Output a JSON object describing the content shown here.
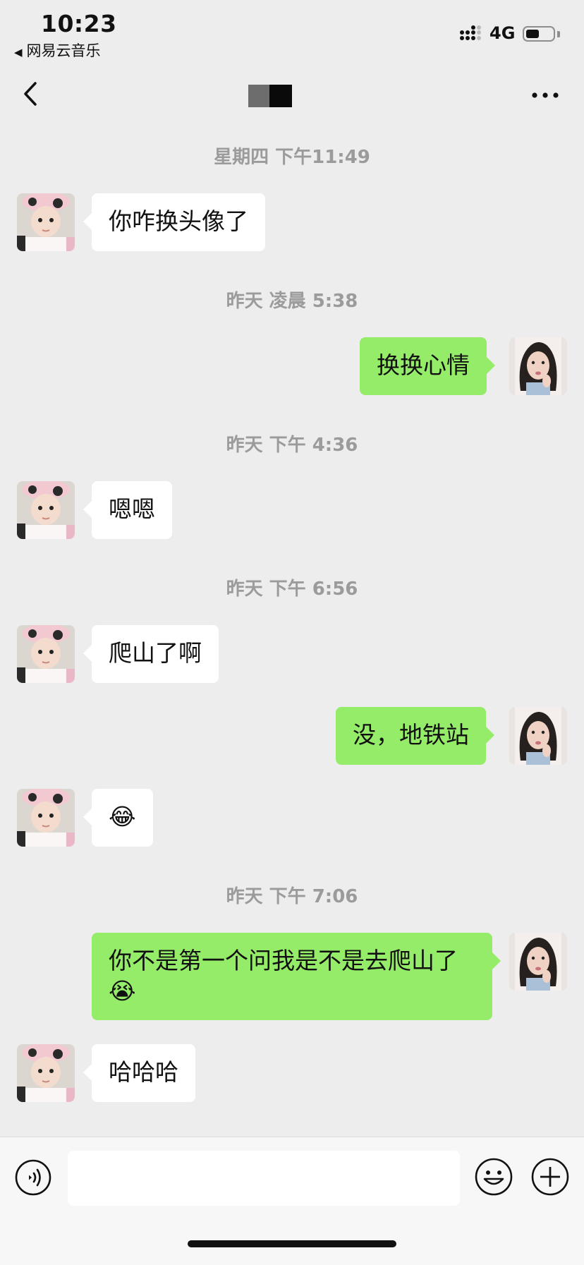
{
  "status_bar": {
    "time": "10:23",
    "back_app_label": "网易云音乐",
    "back_arrow": "◀",
    "network": "4G",
    "battery_level": 0.5
  },
  "nav_bar": {
    "back_icon": "chevron-left-icon",
    "more_icon": "more-dots-icon"
  },
  "messages": [
    {
      "type": "time",
      "text": "星期四 下午11:49"
    },
    {
      "type": "in",
      "text": "你咋换头像了"
    },
    {
      "type": "time",
      "text": "昨天 凌晨 5:38"
    },
    {
      "type": "out",
      "text": "换换心情"
    },
    {
      "type": "time",
      "text": "昨天 下午 4:36"
    },
    {
      "type": "in",
      "text": "嗯嗯"
    },
    {
      "type": "time",
      "text": "昨天 下午 6:56"
    },
    {
      "type": "in",
      "text": "爬山了啊"
    },
    {
      "type": "out",
      "text": "没，地铁站"
    },
    {
      "type": "in",
      "text": "😂"
    },
    {
      "type": "time",
      "text": "昨天 下午 7:06"
    },
    {
      "type": "out",
      "text": "你不是第一个问我是不是去爬山了😭"
    },
    {
      "type": "in",
      "text": "哈哈哈"
    }
  ],
  "input_bar": {
    "value": "",
    "voice_icon": "voice-icon",
    "emoji_icon": "emoji-icon",
    "plus_icon": "plus-icon"
  },
  "colors": {
    "background": "#ededed",
    "incoming_bubble": "#ffffff",
    "outgoing_bubble": "#95ec69",
    "timestamp": "#9b9b9b"
  }
}
